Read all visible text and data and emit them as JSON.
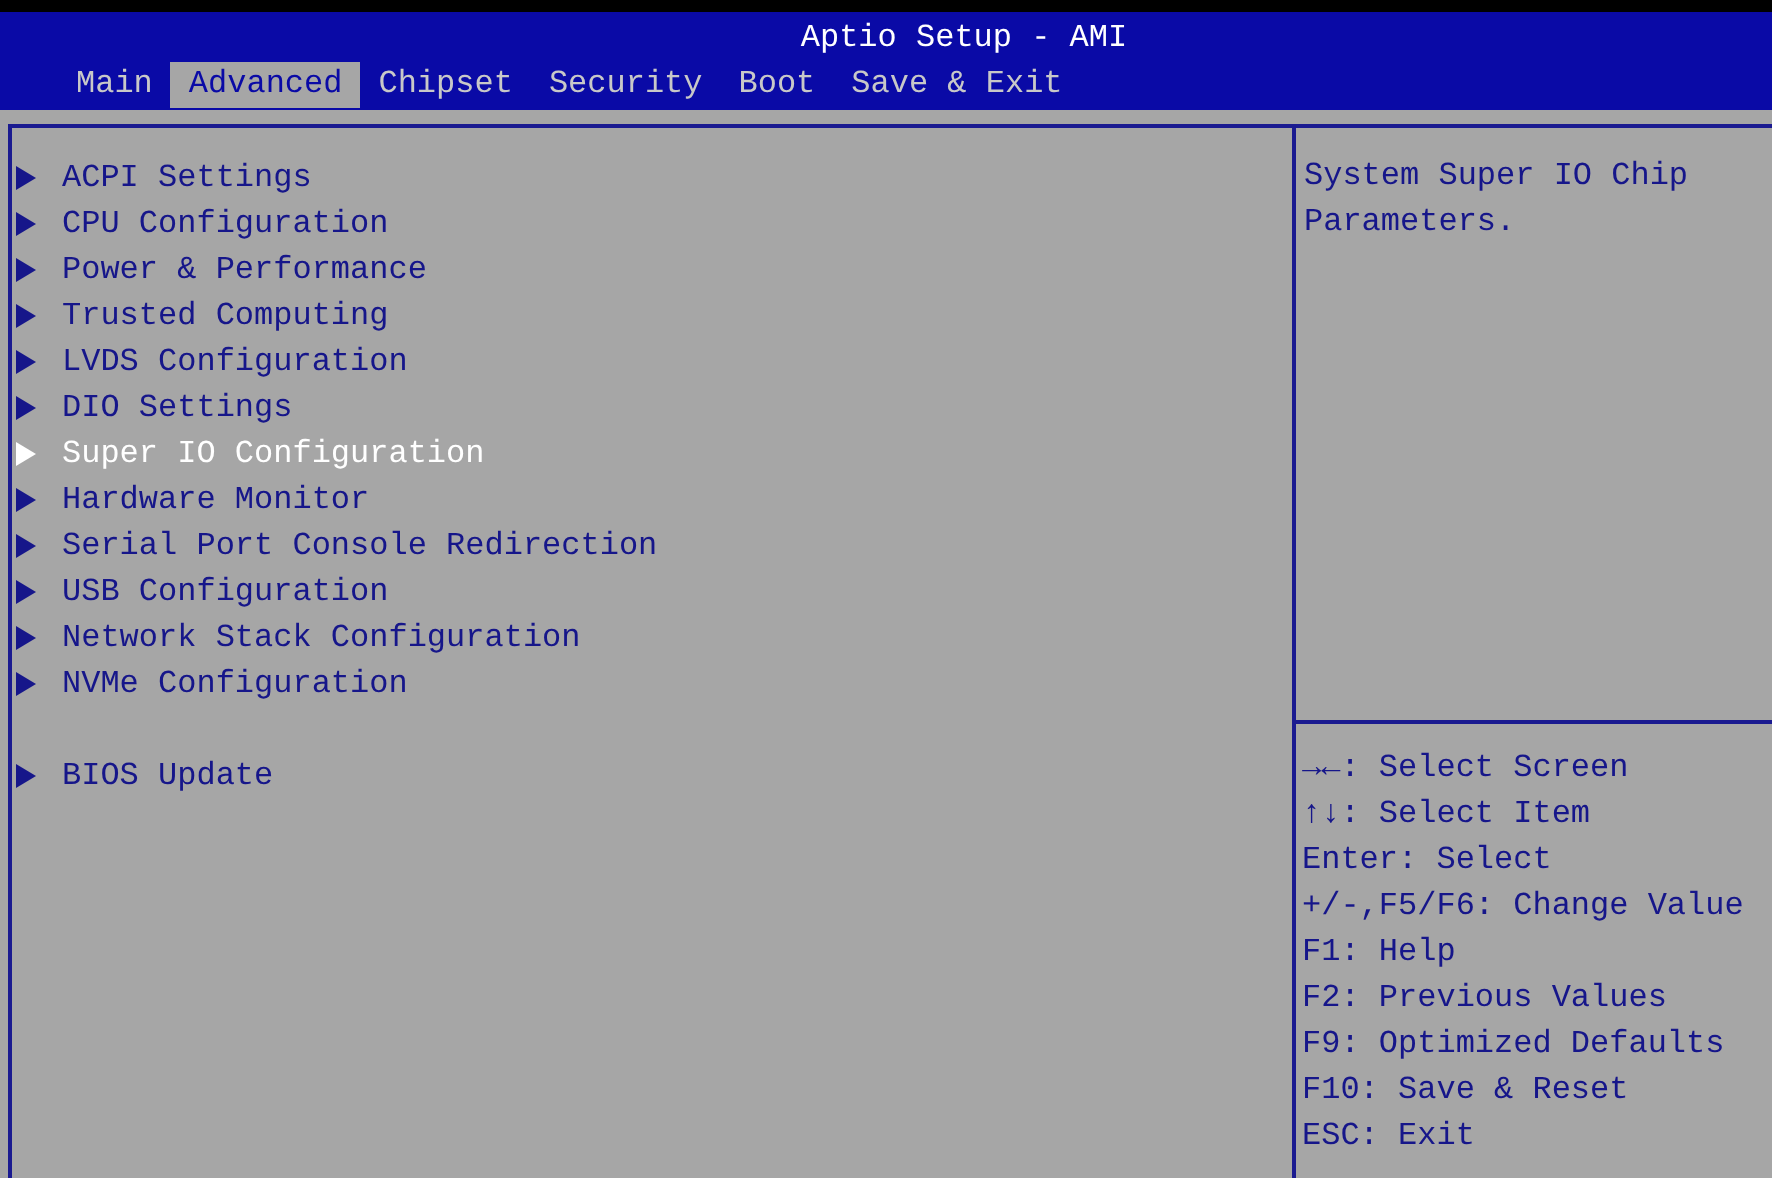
{
  "window": {
    "title": "Aptio Setup - AMI"
  },
  "tabs": [
    {
      "label": "Main",
      "selected": false
    },
    {
      "label": "Advanced",
      "selected": true
    },
    {
      "label": "Chipset",
      "selected": false
    },
    {
      "label": "Security",
      "selected": false
    },
    {
      "label": "Boot",
      "selected": false
    },
    {
      "label": "Save & Exit",
      "selected": false
    }
  ],
  "menu_groups": [
    [
      {
        "label": "ACPI Settings",
        "selected": false
      },
      {
        "label": "CPU Configuration",
        "selected": false
      },
      {
        "label": "Power & Performance",
        "selected": false
      },
      {
        "label": "Trusted Computing",
        "selected": false
      },
      {
        "label": "LVDS Configuration",
        "selected": false
      },
      {
        "label": "DIO Settings",
        "selected": false
      },
      {
        "label": "Super IO Configuration",
        "selected": true
      },
      {
        "label": "Hardware Monitor",
        "selected": false
      },
      {
        "label": "Serial Port Console Redirection",
        "selected": false
      },
      {
        "label": "USB Configuration",
        "selected": false
      },
      {
        "label": "Network Stack Configuration",
        "selected": false
      },
      {
        "label": "NVMe Configuration",
        "selected": false
      }
    ],
    [
      {
        "label": "BIOS Update",
        "selected": false
      }
    ]
  ],
  "help": {
    "description": "System Super IO Chip Parameters.",
    "key_hints": [
      "→←: Select Screen",
      "↑↓: Select Item",
      "Enter: Select",
      "+/-,F5/F6: Change Value",
      "F1: Help",
      "F2: Previous Values",
      "F9: Optimized Defaults",
      "F10: Save & Reset",
      "ESC: Exit"
    ]
  }
}
